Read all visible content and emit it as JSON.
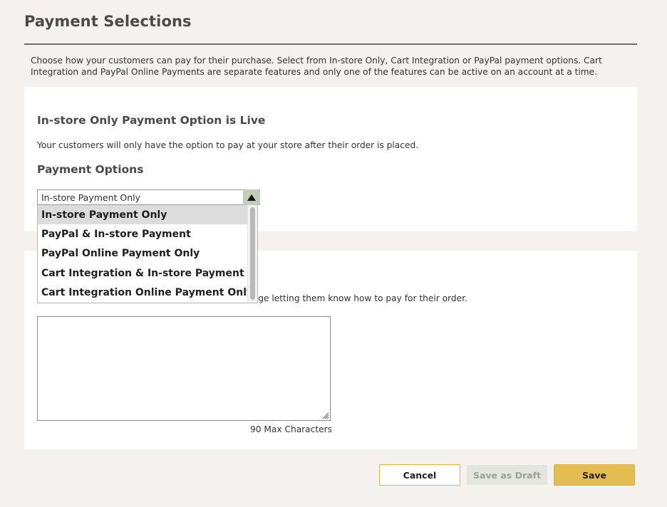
{
  "page": {
    "title": "Payment Selections",
    "intro": "Choose how your customers can pay for their purchase. Select from In-store Only, Cart Integration or PayPal payment options. Cart Integration and PayPal Online Payments are separate features and only one of the features can be active on an account at a time."
  },
  "live_card": {
    "heading": "In-store Only Payment Option is Live",
    "description": "Your customers will only have the option to pay at your store after their order is placed.",
    "options_heading": "Payment Options"
  },
  "payment_select": {
    "selected_value": "In-store Payment Only",
    "options": [
      "In-store Payment Only",
      "PayPal & In-store Payment",
      "PayPal Online Payment Only",
      "Cart Integration & In-store Payment",
      "Cart Integration Online Payment Only"
    ],
    "selected_index": 0
  },
  "message_card": {
    "visible_description_fragment": "page letting them know how to pay for their order.",
    "textarea_value": "",
    "max_chars_label": "90 Max Characters"
  },
  "actions": {
    "cancel_label": "Cancel",
    "draft_label": "Save as Draft",
    "save_label": "Save"
  },
  "colors": {
    "background": "#f4f1ee",
    "card": "#ffffff",
    "accent_gold": "#e3bd52",
    "select_arrow_bg": "#c3ccb8",
    "disabled_button": "#e3e5df"
  },
  "icons": {
    "select_arrow": "triangle-up-icon",
    "textarea_grip": "resize-grip-icon"
  }
}
